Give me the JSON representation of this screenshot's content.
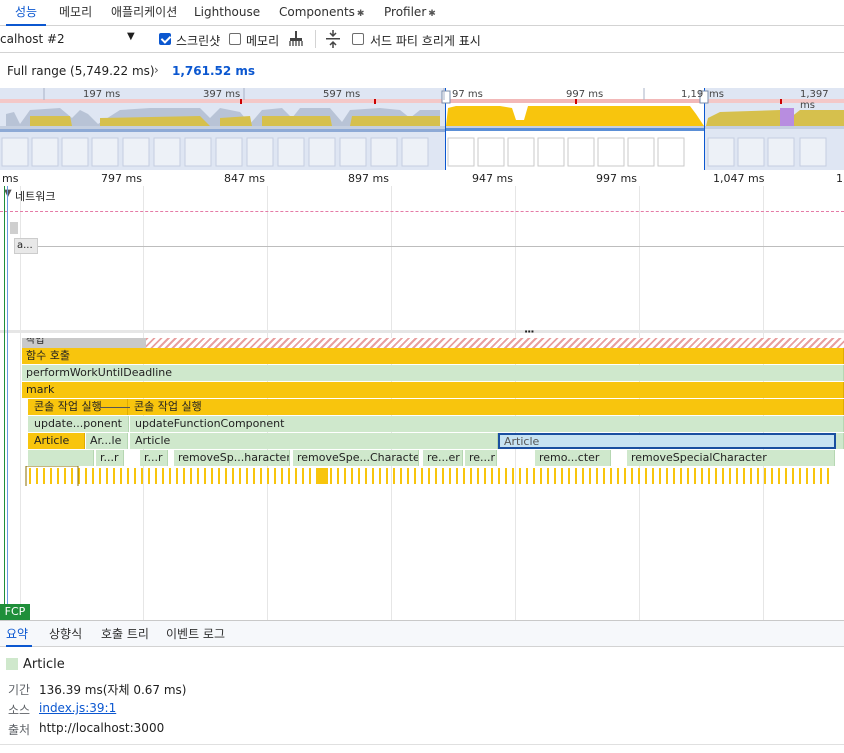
{
  "tabs": [
    "성능",
    "메모리",
    "애플리케이션",
    "Lighthouse",
    "Components",
    "Profiler"
  ],
  "toolbar": {
    "target": "calhost #2",
    "screenshots": "스크린샷",
    "memory": "메모리",
    "third_party": "서드 파티 흐리게 표시"
  },
  "breadcrumb": {
    "full": "Full range (5,749.22 ms)",
    "sep": "›",
    "current": "1,761.52 ms"
  },
  "overview": {
    "ticks": [
      "197 ms",
      "397 ms",
      "597 ms",
      "97 ms",
      "997 ms",
      "1,19",
      "ms",
      "1,397 ms"
    ]
  },
  "ruler": [
    "ms",
    "797 ms",
    "847 ms",
    "897 ms",
    "947 ms",
    "997 ms",
    "1,047 ms",
    "1,"
  ],
  "network": {
    "title": "네트워크",
    "item": "a..."
  },
  "main": {
    "more": "···",
    "task": "작업",
    "rows": {
      "func_call": "함수 호출",
      "perform": "performWorkUntilDeadline",
      "mark": "mark",
      "console1": "콘솔 작업 실행",
      "console2": "콘솔 작업 실행",
      "update1": "update...ponent",
      "update2": "updateFunctionComponent",
      "article1": "Article",
      "article2": "Ar...le",
      "article3": "Article",
      "article4": "Article",
      "r1": "r...r",
      "r2": "r...r",
      "remove1": "removeSp...haracter",
      "remove2": "removeSpe...Character",
      "re1": "re...er",
      "re2": "re...r",
      "remo": "remo...cter",
      "remove3": "removeSpecialCharacter"
    },
    "fcp": "FCP"
  },
  "bottom_tabs": [
    "요약",
    "상향식",
    "호출 트리",
    "이벤트 로그"
  ],
  "summary": {
    "title": "Article",
    "duration_label": "기간",
    "duration": "136.39 ms(자체 0.67 ms)",
    "source_label": "소스",
    "source": "index.js:39:1",
    "origin_label": "출처",
    "origin": "http://localhost:3000"
  },
  "colors": {
    "accent": "#0b57d0",
    "scripting": "#f8c50d",
    "article": "#cfe8cc",
    "selected": "#c7e3f2"
  }
}
